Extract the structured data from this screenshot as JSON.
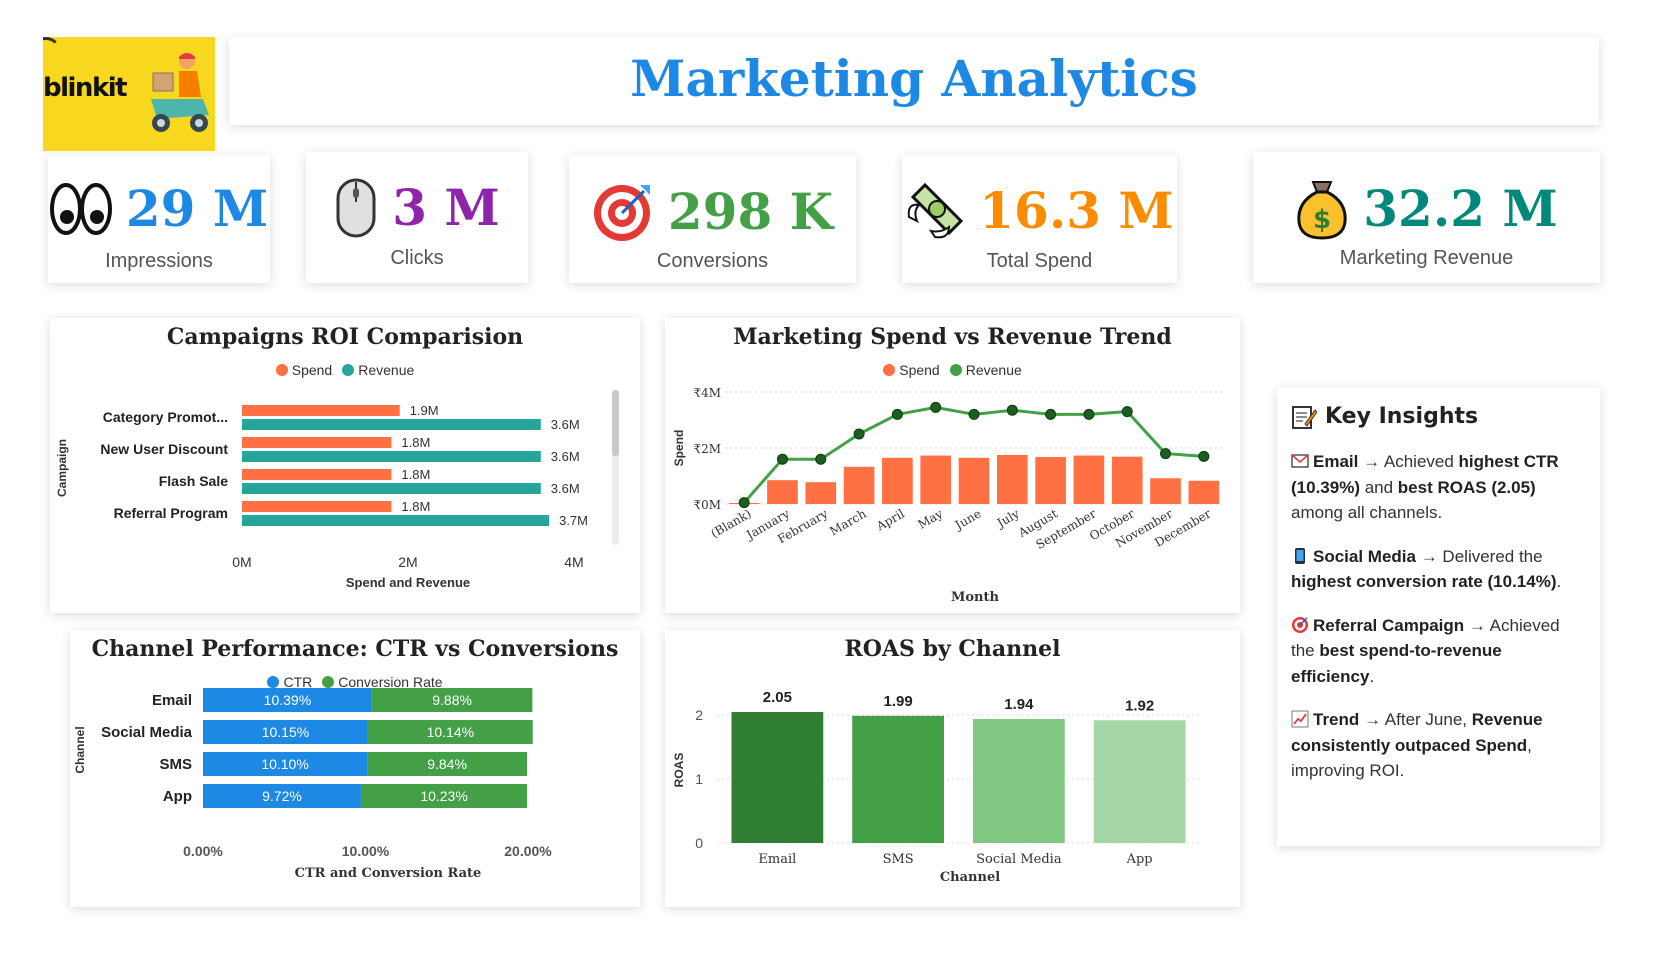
{
  "logo": {
    "text": "blinkit"
  },
  "header": {
    "title": "Marketing Analytics"
  },
  "kpis": [
    {
      "value": "29 M",
      "label": "Impressions",
      "icon": "eyes-icon",
      "color": "#1e88e5"
    },
    {
      "value": "3 M",
      "label": "Clicks",
      "icon": "mouse-icon",
      "color": "#8e24aa"
    },
    {
      "value": "298 K",
      "label": "Conversions",
      "icon": "target-icon",
      "color": "#43a047"
    },
    {
      "value": "16.3 M",
      "label": "Total Spend",
      "icon": "money-wings-icon",
      "color": "#fb8c00"
    },
    {
      "value": "32.2 M",
      "label": "Marketing Revenue",
      "icon": "money-bag-icon",
      "color": "#00897b"
    }
  ],
  "colors": {
    "spend": "#ff7043",
    "revenue": "#26a69a",
    "ctr": "#1e88e5",
    "conv": "#43a047",
    "line": "#43a047"
  },
  "chart_data": [
    {
      "id": "roi",
      "type": "bar",
      "orientation": "horizontal",
      "title": "Campaigns ROI Comparision",
      "ylabel": "Campaign",
      "xlabel": "Spend and Revenue",
      "categories": [
        "Category Promot...",
        "New User Discount",
        "Flash Sale",
        "Referral Program"
      ],
      "series": [
        {
          "name": "Spend",
          "values": [
            1.9,
            1.8,
            1.8,
            1.8
          ],
          "labels": [
            "1.9M",
            "1.8M",
            "1.8M",
            "1.8M"
          ]
        },
        {
          "name": "Revenue",
          "values": [
            3.6,
            3.6,
            3.6,
            3.7
          ],
          "labels": [
            "3.6M",
            "3.6M",
            "3.6M",
            "3.7M"
          ]
        }
      ],
      "xlim": [
        0,
        4
      ],
      "xticks": [
        0,
        2,
        4
      ],
      "xtick_labels": [
        "0M",
        "2M",
        "4M"
      ],
      "legend": "top-center"
    },
    {
      "id": "trend",
      "type": "bar+line",
      "title": "Marketing Spend vs Revenue Trend",
      "xlabel": "Month",
      "ylabel": "Spend",
      "categories": [
        "(Blank)",
        "January",
        "February",
        "March",
        "April",
        "May",
        "June",
        "July",
        "August",
        "September",
        "October",
        "November",
        "December"
      ],
      "series": [
        {
          "name": "Spend",
          "kind": "bar",
          "values": [
            0.0,
            0.85,
            0.78,
            1.33,
            1.65,
            1.73,
            1.65,
            1.75,
            1.68,
            1.73,
            1.69,
            0.92,
            0.83
          ]
        },
        {
          "name": "Revenue",
          "kind": "line",
          "values": [
            0.05,
            1.6,
            1.6,
            2.5,
            3.2,
            3.45,
            3.2,
            3.35,
            3.2,
            3.2,
            3.3,
            1.8,
            1.7
          ]
        }
      ],
      "ylim": [
        0,
        4
      ],
      "yticks": [
        0,
        2,
        4
      ],
      "ytick_labels": [
        "₹0M",
        "₹2M",
        "₹4M"
      ],
      "legend": "top-center",
      "grid": true
    },
    {
      "id": "channel",
      "type": "bar",
      "orientation": "horizontal",
      "stacked": true,
      "title": "Channel Performance: CTR vs Conversions",
      "ylabel": "Channel",
      "xlabel": "CTR and Conversion Rate",
      "categories": [
        "Email",
        "Social Media",
        "SMS",
        "App"
      ],
      "series": [
        {
          "name": "CTR",
          "values": [
            10.39,
            10.15,
            10.1,
            9.72
          ],
          "labels": [
            "10.39%",
            "10.15%",
            "10.10%",
            "9.72%"
          ]
        },
        {
          "name": "Conversion Rate",
          "values": [
            9.88,
            10.14,
            9.84,
            10.23
          ],
          "labels": [
            "9.88%",
            "10.14%",
            "9.84%",
            "10.23%"
          ]
        }
      ],
      "xlim": [
        0,
        20
      ],
      "xticks": [
        0,
        10,
        20
      ],
      "xtick_labels": [
        "0.00%",
        "10.00%",
        "20.00%"
      ],
      "legend": "top-center"
    },
    {
      "id": "roas",
      "type": "bar",
      "title": "ROAS by Channel",
      "xlabel": "Channel",
      "ylabel": "ROAS",
      "categories": [
        "Email",
        "SMS",
        "Social Media",
        "App"
      ],
      "values": [
        2.05,
        1.99,
        1.94,
        1.92
      ],
      "labels": [
        "2.05",
        "1.99",
        "1.94",
        "1.92"
      ],
      "colors": [
        "#2e7d32",
        "#43a047",
        "#81c784",
        "#a5d6a7"
      ],
      "ylim": [
        0,
        2.3
      ],
      "yticks": [
        0,
        1,
        2
      ],
      "ytick_labels": [
        "0",
        "1",
        "2"
      ],
      "grid": true
    }
  ],
  "insights": {
    "title": "Key Insights",
    "items": [
      {
        "icon": "envelope-icon",
        "t1": "Email",
        "t2": " → Achieved ",
        "t3": "highest CTR (10.39%)",
        "t4": " and ",
        "t5": "best ROAS (2.05)",
        "t6": " among all channels."
      },
      {
        "icon": "mobile-phone-icon",
        "t1": "Social Media",
        "t2": " →  Delivered the ",
        "t3": "highest conversion rate (10.14%)",
        "t4": ".",
        "t5": "",
        "t6": ""
      },
      {
        "icon": "target-icon",
        "t1": "Referral Campaign",
        "t2": " → Achieved the ",
        "t3": "best spend-to-revenue efficiency",
        "t4": ".",
        "t5": "",
        "t6": ""
      },
      {
        "icon": "chart-up-icon",
        "t1": "Trend",
        "t2": " → After June, ",
        "t3": "Revenue consistently outpaced Spend",
        "t4": ", improving ROI.",
        "t5": "",
        "t6": ""
      }
    ]
  }
}
